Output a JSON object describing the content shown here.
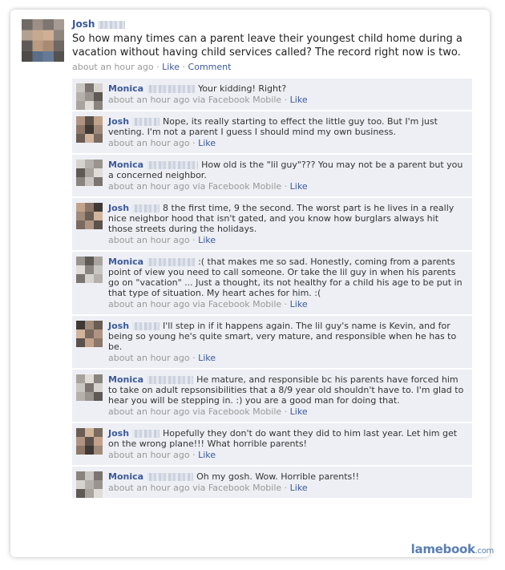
{
  "post": {
    "author": "Josh",
    "text": "So how many times can a parent leave their youngest child home during a vacation without having child services called? The record right now is two.",
    "time": "about an hour ago",
    "like_label": "Like",
    "comment_label": "Comment"
  },
  "comments": [
    {
      "author": "Monica",
      "text": "Your kidding! Right?",
      "time": "about an hour ago",
      "via": "via Facebook Mobile",
      "like": "Like"
    },
    {
      "author": "Josh",
      "text": "Nope, its really starting to effect the little guy too. But I'm just venting. I'm not a parent I guess I should mind my own business.",
      "time": "about an hour ago",
      "via": "",
      "like": "Like"
    },
    {
      "author": "Monica",
      "text": "How old is the \"lil guy\"??? You may not be a parent but you a concerned neighbor.",
      "time": "about an hour ago",
      "via": "via Facebook Mobile",
      "like": "Like"
    },
    {
      "author": "Josh",
      "text": "8 the first time, 9 the second. The worst part is he lives in a really nice neighbor hood that isn't gated, and you know how burglars always hit those streets during the holidays.",
      "time": "about an hour ago",
      "via": "",
      "like": "Like"
    },
    {
      "author": "Monica",
      "text": ":( that makes me so sad. Honestly, coming from a parents point of view you need to call someone. Or take the lil guy in when his parents go on \"vacation\" ... Just a thought, its not healthy for a child his age to be put in that type of situation. My heart aches for him. :(",
      "time": "about an hour ago",
      "via": "via Facebook Mobile",
      "like": "Like"
    },
    {
      "author": "Josh",
      "text": "I'll step in if it happens again. The lil guy's name is Kevin, and for being so young he's quite smart, very mature, and responsible when he has to be.",
      "time": "about an hour ago",
      "via": "",
      "like": "Like"
    },
    {
      "author": "Monica",
      "text": "He mature, and responsible bc his parents have forced him to take on adult repsonsibilities that a 8/9 year old shouldn't have to. I'm glad to hear you will be stepping in. :) you are a good man for doing that.",
      "time": "about an hour ago",
      "via": "via Facebook Mobile",
      "like": "Like"
    },
    {
      "author": "Josh",
      "text": "Hopefully they don't do want they did to him last year. Let him get on the wrong plane!!! What horrible parents!",
      "time": "about an hour ago",
      "via": "",
      "like": "Like"
    },
    {
      "author": "Monica",
      "text": "Oh my gosh. Wow. Horrible parents!!",
      "time": "about an hour ago",
      "via": "via Facebook Mobile",
      "like": "Like"
    }
  ],
  "watermark": {
    "brand": "lamebook",
    "tld": ".com"
  },
  "colors": {
    "link": "#3b5998",
    "comment_bg": "#edeff4",
    "meta": "#999999"
  }
}
